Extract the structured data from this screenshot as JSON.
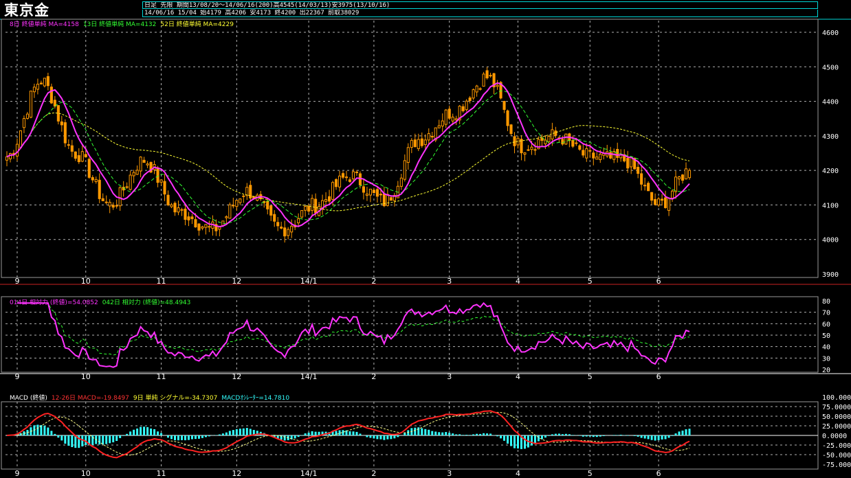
{
  "title": "東京金",
  "info": {
    "line1": "日足  先限  期間13/08/20〜14/06/16(200)高4545(14/03/13)安3975(13/10/16)",
    "line2": "14/06/16 15/04 始4179 高4206 安4173 終4200 出22367 前取38029"
  },
  "main_legend": [
    {
      "text": "8日 終値単純 MA=4158",
      "color": "#ff33ff"
    },
    {
      "text": "13日 終値単純 MA=4132",
      "color": "#33ff33"
    },
    {
      "text": "52日 終値単純 MA=4229",
      "color": "#ffff33"
    }
  ],
  "rsi_legend": [
    {
      "text": "014日 相対力 (終値)=54.0852",
      "color": "#ff33ff"
    },
    {
      "text": "042日 相対力 (終値)=48.4943",
      "color": "#33ff33"
    }
  ],
  "macd_legend": [
    {
      "text": "MACD (終値)",
      "color": "#ffffff"
    },
    {
      "text": "12-26日 MACD=-19.8497",
      "color": "#ff3333"
    },
    {
      "text": "9日 単純 シグナル=-34.7307",
      "color": "#ffff33"
    },
    {
      "text": "MACDｵｼﾚｰﾀｰ=14.7810",
      "color": "#33ffff"
    }
  ],
  "x_labels": [
    "9",
    "10",
    "11",
    "12",
    "14/1",
    "2",
    "3",
    "4",
    "5",
    "6"
  ],
  "price_ticks": [
    "4600",
    "4500",
    "4400",
    "4300",
    "4200",
    "4100",
    "4000",
    "3900"
  ],
  "rsi_ticks": [
    "80",
    "70",
    "60",
    "50",
    "40",
    "30",
    "20"
  ],
  "macd_ticks": [
    "100.0000",
    "75.0000",
    "50.0000",
    "25.0000",
    "0.0000",
    "-25.0000",
    "-50.0000",
    "-75.0000"
  ],
  "chart_data": [
    {
      "type": "candlestick",
      "title": "東京金",
      "ylim": [
        3900,
        4600
      ],
      "colors": {
        "candle": "#ff9900",
        "ma8": "#ff33ff",
        "ma13": "#33ff33",
        "ma52": "#ffff33"
      },
      "anchors_x": [
        0,
        10,
        20,
        30,
        40,
        50,
        60,
        70,
        80,
        90,
        100,
        110,
        120,
        130,
        140,
        150,
        160,
        170,
        180,
        190,
        199
      ],
      "anchors_close": [
        4240,
        4460,
        4250,
        4100,
        4230,
        4080,
        4030,
        4140,
        4030,
        4100,
        4185,
        4110,
        4290,
        4370,
        4470,
        4270,
        4300,
        4240,
        4230,
        4100,
        4200
      ],
      "ma_last": {
        "ma8": 4158,
        "ma13": 4132,
        "ma52": 4229
      },
      "high": 4545,
      "low": 3975,
      "last": {
        "open": 4179,
        "high": 4206,
        "low": 4173,
        "close": 4200
      }
    },
    {
      "type": "line",
      "title": "相対力",
      "ylim": [
        20,
        80
      ],
      "series": [
        {
          "name": "014日 相対力 (終値)",
          "last": 54.0852
        },
        {
          "name": "042日 相対力 (終値)",
          "last": 48.4943
        }
      ]
    },
    {
      "type": "line",
      "title": "MACD (終値)",
      "ylim": [
        -75,
        100
      ],
      "series": [
        {
          "name": "12-26日 MACD",
          "last": -19.8497
        },
        {
          "name": "9日 単純 シグナル",
          "last": -34.7307
        },
        {
          "name": "MACDｵｼﾚｰﾀｰ",
          "last": 14.781
        }
      ]
    }
  ]
}
